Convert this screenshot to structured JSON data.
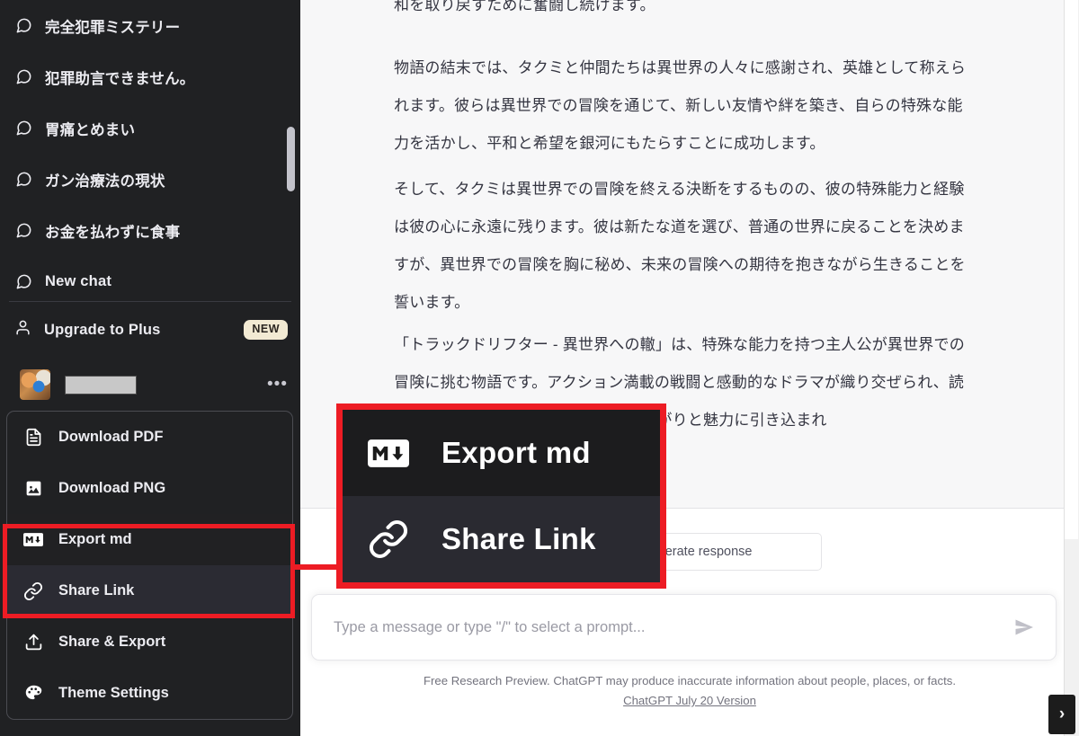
{
  "colors": {
    "sidebar_bg": "#202123",
    "menu_bg": "#212123",
    "highlight_red": "#ed1c24",
    "thread_bg": "#f7f7f8",
    "text_primary": "#343541",
    "badge_bg": "#f2ead3"
  },
  "sidebar": {
    "chats": [
      {
        "label": "完全犯罪ミステリー",
        "icon": "message-square-icon"
      },
      {
        "label": "犯罪助言できません。",
        "icon": "message-square-icon"
      },
      {
        "label": "胃痛とめまい",
        "icon": "message-square-icon"
      },
      {
        "label": "ガン治療法の現状",
        "icon": "message-square-icon"
      },
      {
        "label": "お金を払わずに食事",
        "icon": "message-square-icon"
      },
      {
        "label": "New chat",
        "icon": "message-square-icon"
      }
    ],
    "upgrade": {
      "label": "Upgrade to Plus",
      "icon": "person-icon",
      "badge": "NEW"
    },
    "user": {
      "name": "",
      "avatar_icon": "user-avatar",
      "more_icon": "ellipsis-icon"
    },
    "menu": [
      {
        "label": "Download PDF",
        "icon": "file-text-icon",
        "state": "normal"
      },
      {
        "label": "Download PNG",
        "icon": "image-icon",
        "state": "normal"
      },
      {
        "label": "Export md",
        "icon": "markdown-icon",
        "state": "selected"
      },
      {
        "label": "Share Link",
        "icon": "link-icon",
        "state": "hover"
      },
      {
        "label": "Share & Export",
        "icon": "upload-icon",
        "state": "normal"
      },
      {
        "label": "Theme Settings",
        "icon": "palette-icon",
        "state": "normal"
      }
    ]
  },
  "callout": {
    "items": [
      {
        "label": "Export md",
        "icon": "markdown-icon",
        "state": "selected"
      },
      {
        "label": "Share Link",
        "icon": "link-icon",
        "state": "hover"
      }
    ]
  },
  "main": {
    "paragraphs": [
      "和を取り戻すために奮闘し続けます。",
      "物語の結末では、タクミと仲間たちは異世界の人々に感謝され、英雄として称えられます。彼らは異世界での冒険を通じて、新しい友情や絆を築き、自らの特殊な能力を活かし、平和と希望を銀河にもたらすことに成功します。",
      "そして、タクミは異世界での冒険を終える決断をするものの、彼の特殊能力と経験は彼の心に永遠に残ります。彼は新たな道を選び、普通の世界に戻ることを決めますが、異世界での冒険を胸に秘め、未来の冒険への期待を抱きながら生きることを誓います。",
      "「トラックドリフター - 異世界への轍」は、特殊な能力を持つ主人公が異世界での冒険に挑む物語です。アクション満載の戦闘と感動的なドラマが織り交ぜられ、読者は主人公と共に成長し、異世界の広がりと魅力に引き込まれ"
    ],
    "regenerate_button": "Regenerate response",
    "composer": {
      "placeholder": "Type a message or type \"/\" to select a prompt...",
      "value": "",
      "send_icon": "send-icon"
    },
    "footer": {
      "disclaimer": "Free Research Preview. ChatGPT may produce inaccurate information about people, places, or facts.",
      "version_link": "ChatGPT July 20 Version"
    },
    "expand_tab": "›"
  }
}
